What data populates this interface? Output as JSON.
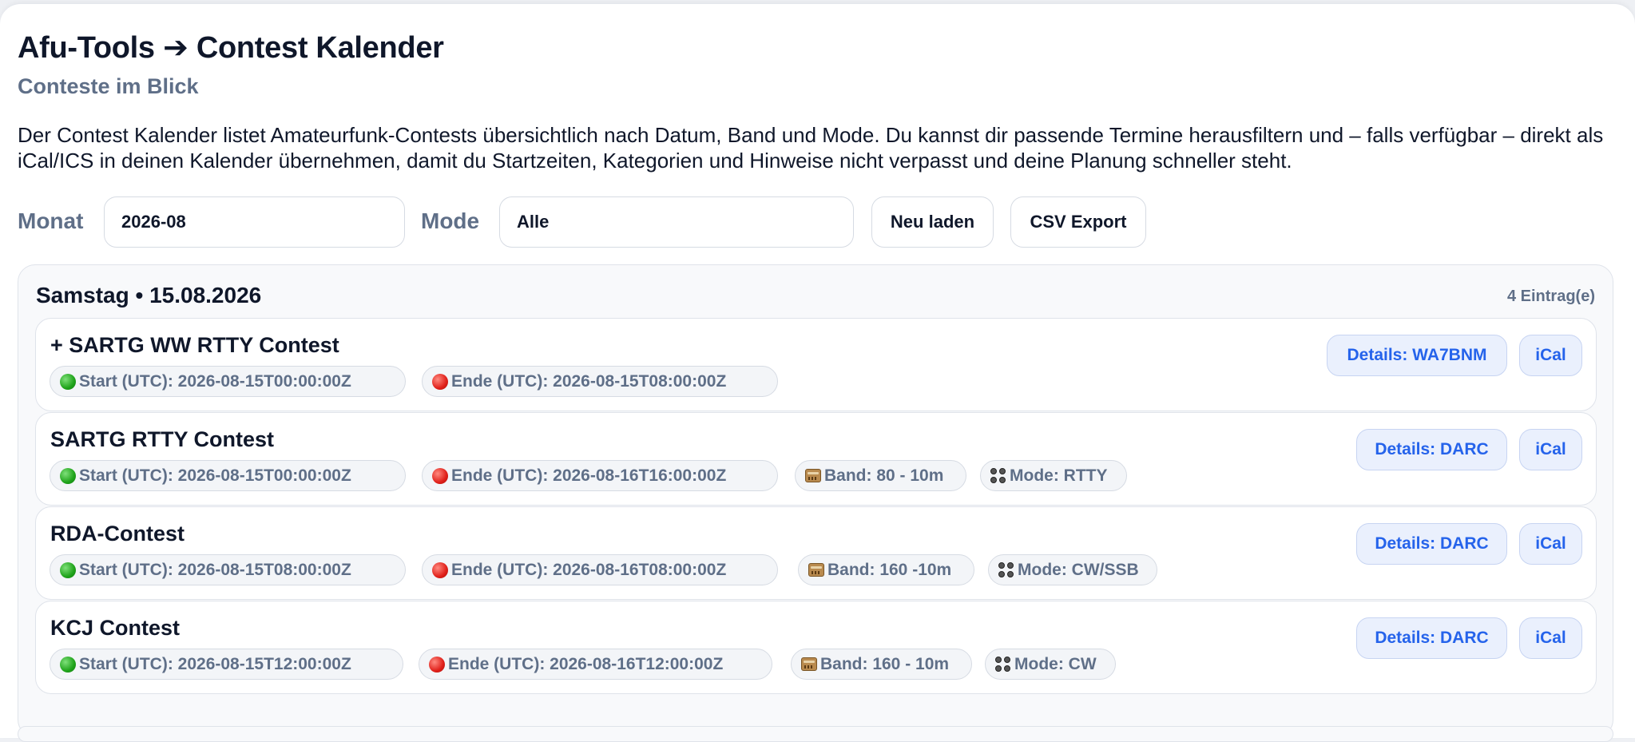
{
  "page": {
    "title": "Afu-Tools ➔ Contest Kalender",
    "subtitle": "Conteste im Blick",
    "intro": "Der Contest Kalender listet Amateurfunk-Contests übersichtlich nach Datum, Band und Mode. Du kannst dir passende Termine herausfiltern und – falls verfügbar – direkt als iCal/ICS in deinen Kalender übernehmen, damit du Startzeiten, Kategorien und Hinweise nicht verpasst und deine Planung schneller steht."
  },
  "filters": {
    "month_label": "Monat",
    "month_value": "2026-08",
    "mode_label": "Mode",
    "mode_value": "Alle",
    "reload_label": "Neu laden",
    "csv_label": "CSV Export"
  },
  "day": {
    "title": "Samstag • 15.08.2026",
    "count": "4 Eintrag(e)"
  },
  "entries": [
    {
      "title": "+ SARTG WW RTTY Contest",
      "start": "Start (UTC): 2026-08-15T00:00:00Z",
      "end": "Ende (UTC): 2026-08-15T08:00:00Z",
      "details": "Details: WA7BNM",
      "ical": "iCal"
    },
    {
      "title": "SARTG RTTY Contest",
      "start": "Start (UTC): 2026-08-15T00:00:00Z",
      "end": "Ende (UTC): 2026-08-16T16:00:00Z",
      "band": "Band: 80 - 10m",
      "mode": "Mode: RTTY",
      "details": "Details: DARC",
      "ical": "iCal"
    },
    {
      "title": "RDA-Contest",
      "start": "Start (UTC): 2026-08-15T08:00:00Z",
      "end": "Ende (UTC): 2026-08-16T08:00:00Z",
      "band": "Band: 160 -10m",
      "mode": "Mode: CW/SSB",
      "details": "Details: DARC",
      "ical": "iCal"
    },
    {
      "title": "KCJ Contest",
      "start": "Start (UTC): 2026-08-15T12:00:00Z",
      "end": "Ende (UTC): 2026-08-16T12:00:00Z",
      "band": "Band: 160 - 10m",
      "mode": "Mode: CW",
      "details": "Details: DARC",
      "ical": "iCal"
    }
  ],
  "icons": {
    "start": "green-circle-icon",
    "end": "red-circle-icon",
    "band": "radio-icon",
    "mode": "control-knobs-icon"
  },
  "colors": {
    "link": "#2563eb",
    "muted": "#5f6f88",
    "heading": "#0f172a"
  }
}
